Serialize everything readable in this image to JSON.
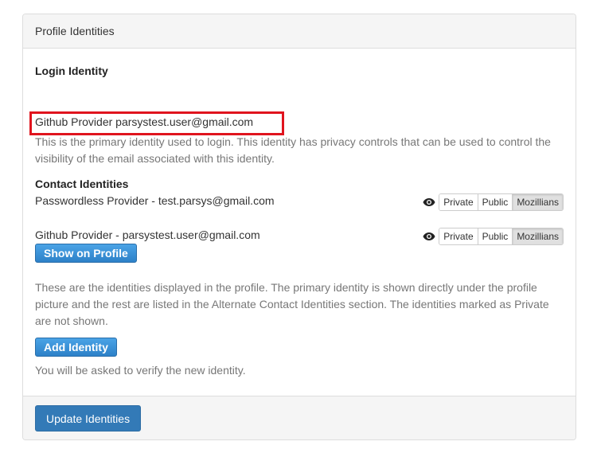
{
  "panel": {
    "title": "Profile Identities"
  },
  "login": {
    "heading": "Login Identity",
    "identity": "Github Provider parsystest.user@gmail.com",
    "description": "This is the primary identity used to login. This identity has privacy controls that can be used to control the visibility of the email associated with this identity."
  },
  "contacts": {
    "heading": "Contact Identities",
    "items": [
      {
        "label": "Passwordless Provider - test.parsys@gmail.com",
        "privacy_options": [
          "Private",
          "Public",
          "Mozillians"
        ],
        "selected": "Mozillians"
      },
      {
        "label": "Github Provider - parsystest.user@gmail.com",
        "privacy_options": [
          "Private",
          "Public",
          "Mozillians"
        ],
        "selected": "Mozillians",
        "show_on_profile_label": "Show on Profile"
      }
    ],
    "description": "These are the identities displayed in the profile. The primary identity is shown directly under the profile picture and the rest are listed in the Alternate Contact Identities section. The identities marked as Private are not shown.",
    "add_button": "Add Identity",
    "verify_note": "You will be asked to verify the new identity."
  },
  "footer": {
    "update_button": "Update Identities"
  },
  "colors": {
    "highlight": "#e0141e",
    "primary": "#337ab7",
    "button_gradient_top": "#4aa3e6",
    "button_gradient_bottom": "#2d81c8"
  }
}
